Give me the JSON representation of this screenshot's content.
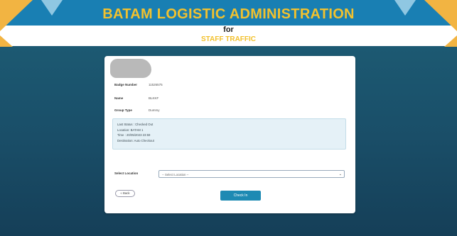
{
  "header": {
    "title": "BATAM LOGISTIC ADMINISTRATION",
    "for_text": "for",
    "subtitle": "STAFF TRAFFIC"
  },
  "profile": {
    "fields": [
      {
        "label": "Badge Number",
        "value": "11526575"
      },
      {
        "label": "Name",
        "value": "BLKKF"
      },
      {
        "label": "Group Type",
        "value": "Dummy"
      }
    ]
  },
  "status": {
    "lines": [
      "Last Status : Checked Out",
      "Location: BATAM 1",
      "Time : 20/05/2023 23:59",
      "Destination: Auto Checkout"
    ]
  },
  "form": {
    "select_label": "Select Location",
    "select_value": "-- Select Location --",
    "back_label": "« Back",
    "checkin_label": "Check In"
  },
  "colors": {
    "header_blue": "#197fb3",
    "title_yellow": "#f2c12e",
    "background_teal": "#1d5f77",
    "button_blue": "#1e8ab3"
  }
}
